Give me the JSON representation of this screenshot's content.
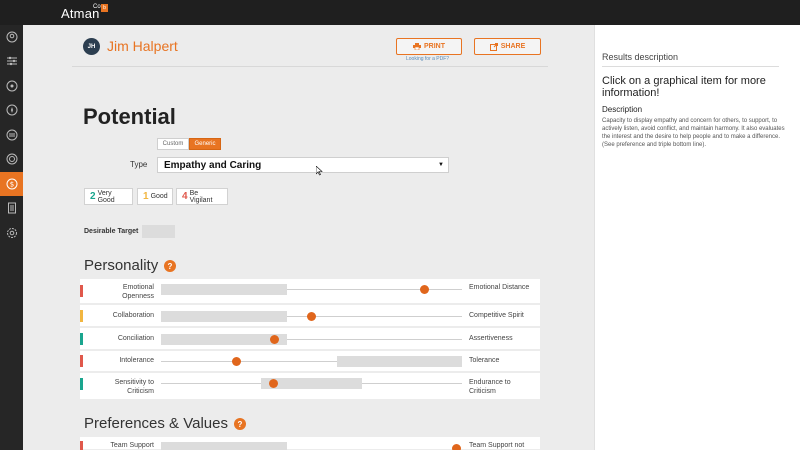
{
  "app": {
    "brand": "Atman",
    "brand_sup": "Co.",
    "brand_mark": "b"
  },
  "sidebar": {
    "items": [
      {
        "icon": "user-circle-icon"
      },
      {
        "icon": "sliders-icon"
      },
      {
        "icon": "network-icon"
      },
      {
        "icon": "compass-icon"
      },
      {
        "icon": "swap-icon"
      },
      {
        "icon": "gift-icon"
      },
      {
        "icon": "potential-icon",
        "active": true
      },
      {
        "icon": "document-icon"
      },
      {
        "icon": "gear-icon"
      }
    ]
  },
  "header": {
    "initials": "JH",
    "name": "Jim Halpert",
    "print_label": "PRINT",
    "share_label": "SHARE",
    "pdf_link": "Looking for a PDF?"
  },
  "potential": {
    "title": "Potential",
    "toggle_custom": "Custom",
    "toggle_generic": "Generic",
    "type_label": "Type",
    "type_value": "Empathy and Caring",
    "legend": [
      {
        "num": "2",
        "text": "Very Good",
        "color": "#1aa58e"
      },
      {
        "num": "1",
        "text": "Good",
        "color": "#f2b640"
      },
      {
        "num": "4",
        "text": "Be Vigilant",
        "color": "#e0584b"
      }
    ],
    "target_label": "Desirable Target"
  },
  "personality": {
    "title": "Personality",
    "help": "?",
    "rows": [
      {
        "left": "Emotional Openness",
        "right": "Emotional Distance",
        "flag": "#e0584b"
      },
      {
        "left": "Collaboration",
        "right": "Competitive Spirit",
        "flag": "#f2b640"
      },
      {
        "left": "Conciliation",
        "right": "Assertiveness",
        "flag": "#1aa58e"
      },
      {
        "left": "Intolerance",
        "right": "Tolerance",
        "flag": "#e0584b"
      },
      {
        "left": "Sensitivity to Criticism",
        "right": "Endurance to Criticism",
        "flag": "#1aa58e"
      }
    ]
  },
  "preferences": {
    "title": "Preferences & Values",
    "help": "?",
    "rows": [
      {
        "left": "Team Support",
        "right": "Team Support not",
        "flag": "#e0584b"
      }
    ]
  },
  "results": {
    "heading": "Results description",
    "click_text": "Click on a graphical item for more information!",
    "desc_title": "Description",
    "desc_text": "Capacity to display empathy and concern for others, to support, to actively listen, avoid conflict, and maintain harmony. It also evaluates the interest and the desire to help people and to make a difference. (See preference and triple bottom line)."
  }
}
